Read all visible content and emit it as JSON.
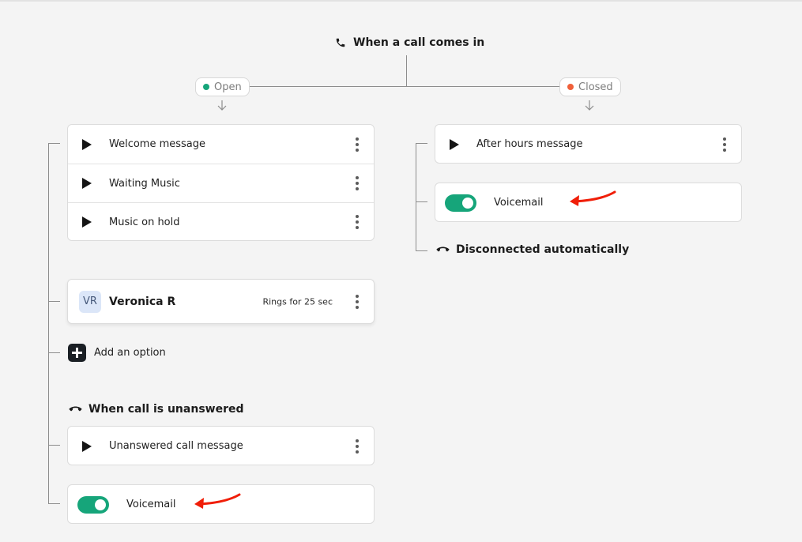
{
  "header": {
    "title": "When a call comes in",
    "icon": "phone-icon"
  },
  "branches": {
    "open": {
      "label": "Open",
      "color": "#16a57a"
    },
    "closed": {
      "label": "Closed",
      "color": "#f0603a"
    }
  },
  "open": {
    "messages": [
      {
        "label": "Welcome message"
      },
      {
        "label": "Waiting Music"
      },
      {
        "label": "Music on hold"
      }
    ],
    "person": {
      "initials": "VR",
      "name": "Veronica R",
      "rings": "Rings for 25 sec"
    },
    "add_option_label": "Add an option",
    "unanswered": {
      "title": "When call is unanswered",
      "message": "Unanswered call message",
      "voicemail": "Voicemail"
    }
  },
  "closed": {
    "message": "After hours message",
    "voicemail": "Voicemail",
    "disconnect": "Disconnected automatically"
  },
  "colors": {
    "toggle_on": "#16a57a",
    "annotation_arrow": "#f01e08"
  }
}
